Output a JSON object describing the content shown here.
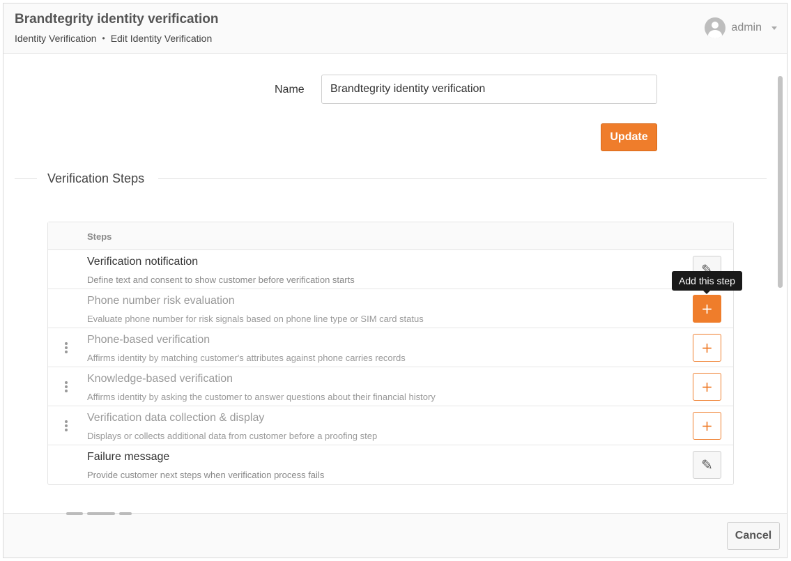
{
  "header": {
    "title": "Brandtegrity identity verification",
    "breadcrumb": {
      "parent": "Identity Verification",
      "separator": "•",
      "current": "Edit Identity Verification"
    },
    "user": {
      "name": "admin",
      "avatar_icon": "user-avatar-icon",
      "menu_icon": "caret-down-icon"
    }
  },
  "form": {
    "name_label": "Name",
    "name_value": "Brandtegrity identity verification",
    "update_label": "Update"
  },
  "section": {
    "title": "Verification Steps"
  },
  "steps": {
    "header": "Steps",
    "rows": [
      {
        "title": "Verification notification",
        "description": "Define text and consent to show customer before verification starts",
        "action": "edit",
        "icon": "edit-icon"
      },
      {
        "title": "Phone number risk evaluation",
        "description": "Evaluate phone number for risk signals based on phone line type or SIM card status",
        "action": "add",
        "icon": "plus-icon"
      },
      {
        "title": "Phone-based verification",
        "description": "Affirms identity by matching customer's attributes against phone carries records",
        "action": "add",
        "icon": "plus-icon"
      },
      {
        "title": "Knowledge-based verification",
        "description": "Affirms identity by asking the customer to answer questions about their financial history",
        "action": "add",
        "icon": "plus-icon"
      },
      {
        "title": "Verification data collection & display",
        "description": "Displays or collects additional data from customer before a proofing step",
        "action": "add",
        "icon": "plus-icon"
      },
      {
        "title": "Failure message",
        "description": "Provide customer next steps when verification process fails",
        "action": "edit",
        "icon": "edit-icon"
      }
    ],
    "edit_glyph": "✎",
    "add_glyph": "+"
  },
  "tooltip": "Add this step",
  "footer": {
    "cancel_label": "Cancel"
  },
  "colors": {
    "accent": "#ef7d2b",
    "header_bg": "#fafafa",
    "tooltip_bg": "#1a1a1a"
  }
}
